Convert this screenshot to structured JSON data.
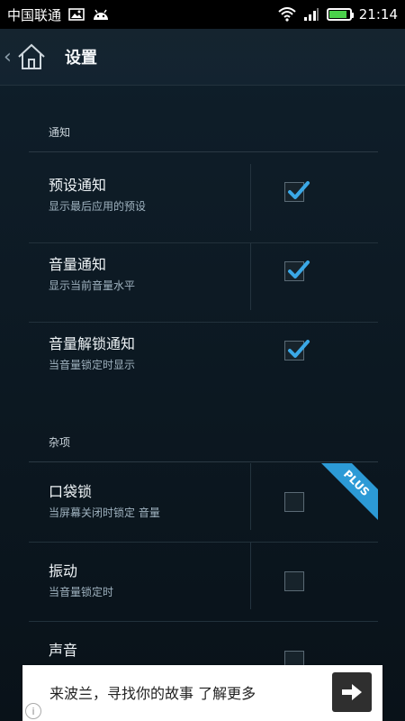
{
  "status_bar": {
    "carrier": "中国联通",
    "time": "21:14",
    "icons": [
      "image-icon",
      "android-icon",
      "wifi-icon",
      "signal-icon",
      "battery-icon"
    ]
  },
  "header": {
    "title": "设置",
    "back_icon": "back-chevron-icon",
    "home_icon": "home-icon"
  },
  "sections": [
    {
      "header": "通知",
      "items": [
        {
          "title": "预设通知",
          "summary": "显示最后应用的预设",
          "checked": true
        },
        {
          "title": "音量通知",
          "summary": "显示当前音量水平",
          "checked": true
        },
        {
          "title": "音量解锁通知",
          "summary": "当音量锁定时显示",
          "checked": true
        }
      ]
    },
    {
      "header": "杂项",
      "items": [
        {
          "title": "口袋锁",
          "summary": "当屏幕关闭时锁定 音量",
          "checked": false,
          "badge": "PLUS"
        },
        {
          "title": "振动",
          "summary": "当音量锁定时",
          "checked": false
        },
        {
          "title": "声音",
          "summary": "",
          "checked": false
        }
      ]
    }
  ],
  "ad": {
    "text": "来波兰，寻找你的故事 了解更多",
    "button_icon": "arrow-right-icon",
    "info_icon": "info-icon"
  },
  "colors": {
    "accent": "#2c9ad6",
    "check": "#3aa8e6",
    "background": "#0d1a24"
  }
}
